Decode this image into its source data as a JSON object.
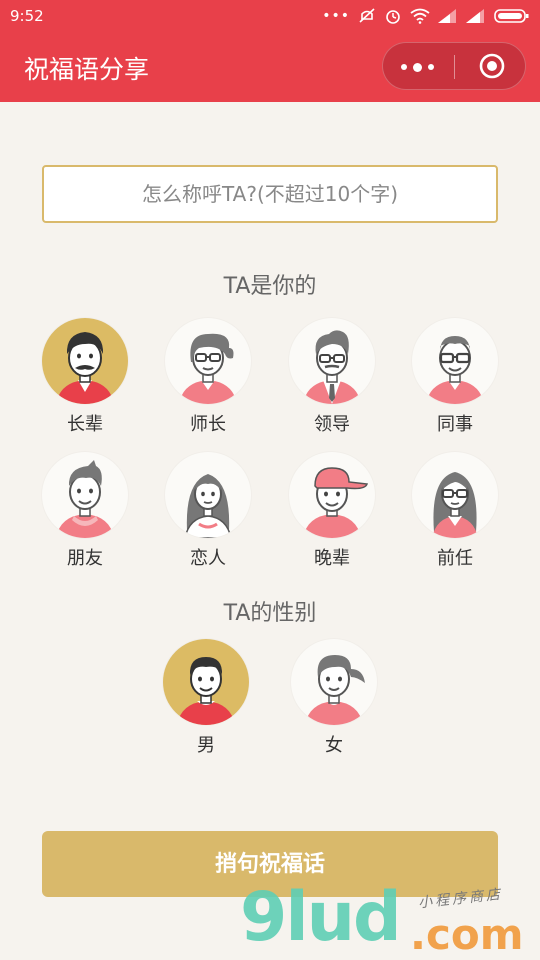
{
  "status_bar": {
    "time": "9:52"
  },
  "nav": {
    "title": "祝福语分享"
  },
  "name_input": {
    "placeholder": "怎么称呼TA?(不超过10个字)"
  },
  "relation_section": {
    "title": "TA是你的",
    "items": [
      {
        "label": "长辈",
        "selected": true
      },
      {
        "label": "师长",
        "selected": false
      },
      {
        "label": "领导",
        "selected": false
      },
      {
        "label": "同事",
        "selected": false
      },
      {
        "label": "朋友",
        "selected": false
      },
      {
        "label": "恋人",
        "selected": false
      },
      {
        "label": "晚辈",
        "selected": false
      },
      {
        "label": "前任",
        "selected": false
      }
    ]
  },
  "gender_section": {
    "title": "TA的性别",
    "items": [
      {
        "label": "男",
        "selected": true
      },
      {
        "label": "女",
        "selected": false
      }
    ]
  },
  "action_button": {
    "label": "捎句祝福话"
  },
  "watermark": {
    "main": "9lud",
    "suffix": ".com",
    "sub": "小程序商店"
  },
  "colors": {
    "primary_red": "#e8404a",
    "gold": "#d9b96b",
    "background": "#f6f3ee"
  }
}
